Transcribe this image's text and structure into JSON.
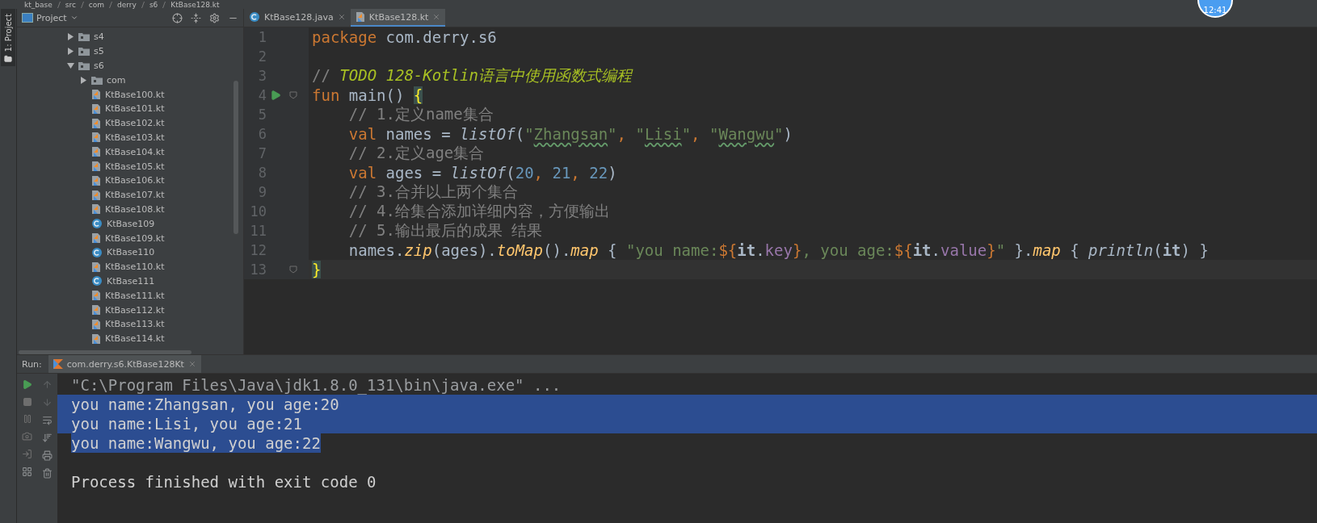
{
  "breadcrumb": [
    "kt_base",
    "src",
    "com",
    "derry",
    "s6",
    "KtBase128.kt"
  ],
  "clock_badge": "12:41",
  "tool_stripe": {
    "label": "1: Project"
  },
  "project_panel": {
    "title": "Project",
    "tree": [
      {
        "label": "s4",
        "kind": "folder",
        "expanded": false
      },
      {
        "label": "s5",
        "kind": "folder",
        "expanded": false
      },
      {
        "label": "s6",
        "kind": "folder",
        "expanded": true,
        "children": [
          {
            "label": "com",
            "kind": "folder",
            "expanded": false
          },
          {
            "label": "KtBase100.kt",
            "kind": "kotlin-file"
          },
          {
            "label": "KtBase101.kt",
            "kind": "kotlin-file"
          },
          {
            "label": "KtBase102.kt",
            "kind": "kotlin-file"
          },
          {
            "label": "KtBase103.kt",
            "kind": "kotlin-file"
          },
          {
            "label": "KtBase104.kt",
            "kind": "kotlin-file"
          },
          {
            "label": "KtBase105.kt",
            "kind": "kotlin-file"
          },
          {
            "label": "KtBase106.kt",
            "kind": "kotlin-file"
          },
          {
            "label": "KtBase107.kt",
            "kind": "kotlin-file"
          },
          {
            "label": "KtBase108.kt",
            "kind": "kotlin-file"
          },
          {
            "label": "KtBase109",
            "kind": "class"
          },
          {
            "label": "KtBase109.kt",
            "kind": "kotlin-file"
          },
          {
            "label": "KtBase110",
            "kind": "class"
          },
          {
            "label": "KtBase110.kt",
            "kind": "kotlin-file"
          },
          {
            "label": "KtBase111",
            "kind": "class"
          },
          {
            "label": "KtBase111.kt",
            "kind": "kotlin-file"
          },
          {
            "label": "KtBase112.kt",
            "kind": "kotlin-file"
          },
          {
            "label": "KtBase113.kt",
            "kind": "kotlin-file"
          },
          {
            "label": "KtBase114.kt",
            "kind": "kotlin-file"
          }
        ]
      }
    ]
  },
  "editor_tabs": [
    {
      "label": "KtBase128.java",
      "kind": "java",
      "selected": false
    },
    {
      "label": "KtBase128.kt",
      "kind": "kotlin",
      "selected": true
    }
  ],
  "code_lines": [
    {
      "number": "1",
      "tokens": [
        {
          "text": "package",
          "kind": "keyword"
        },
        {
          "text": " com.derry.s6",
          "kind": "plain"
        }
      ]
    },
    {
      "number": "2"
    },
    {
      "number": "3",
      "tokens": [
        {
          "text": "// ",
          "kind": "comment"
        },
        {
          "text": "TODO 128-Kotlin语言中使用函数式编程",
          "kind": "todo"
        }
      ]
    },
    {
      "number": "4",
      "runnable": true,
      "fold": true,
      "tokens": [
        {
          "text": "fun",
          "kind": "keyword"
        },
        {
          "text": " main() ",
          "kind": "plain"
        },
        {
          "text": "{",
          "kind": "brace-match"
        }
      ]
    },
    {
      "number": "5",
      "tokens": [
        {
          "text": "    // 1.定义name集合",
          "kind": "comment"
        }
      ]
    },
    {
      "number": "6",
      "tokens": [
        {
          "text": "    val",
          "kind": "keyword"
        },
        {
          "text": " names = ",
          "kind": "plain"
        },
        {
          "text": "listOf",
          "kind": "call"
        },
        {
          "text": "(",
          "kind": "plain"
        },
        {
          "text": "\"",
          "kind": "string"
        },
        {
          "text": "Zhangsan",
          "kind": "string-typo"
        },
        {
          "text": "\"",
          "kind": "string"
        },
        {
          "text": ", ",
          "kind": "keyword"
        },
        {
          "text": "\"",
          "kind": "string"
        },
        {
          "text": "Lisi",
          "kind": "string-typo"
        },
        {
          "text": "\"",
          "kind": "string"
        },
        {
          "text": ", ",
          "kind": "keyword"
        },
        {
          "text": "\"",
          "kind": "string"
        },
        {
          "text": "Wangwu",
          "kind": "string-typo"
        },
        {
          "text": "\"",
          "kind": "string"
        },
        {
          "text": ")",
          "kind": "plain"
        }
      ]
    },
    {
      "number": "7",
      "tokens": [
        {
          "text": "    // 2.定义age集合",
          "kind": "comment"
        }
      ]
    },
    {
      "number": "8",
      "tokens": [
        {
          "text": "    val",
          "kind": "keyword"
        },
        {
          "text": " ages = ",
          "kind": "plain"
        },
        {
          "text": "listOf",
          "kind": "call"
        },
        {
          "text": "(",
          "kind": "plain"
        },
        {
          "text": "20",
          "kind": "number"
        },
        {
          "text": ", ",
          "kind": "keyword"
        },
        {
          "text": "21",
          "kind": "number"
        },
        {
          "text": ", ",
          "kind": "keyword"
        },
        {
          "text": "22",
          "kind": "number"
        },
        {
          "text": ")",
          "kind": "plain"
        }
      ]
    },
    {
      "number": "9",
      "tokens": [
        {
          "text": "    // 3.合并以上两个集合",
          "kind": "comment"
        }
      ]
    },
    {
      "number": "10",
      "tokens": [
        {
          "text": "    // 4.给集合添加详细内容，方便输出",
          "kind": "comment"
        }
      ]
    },
    {
      "number": "11",
      "tokens": [
        {
          "text": "    // 5.输出最后的成果 结果",
          "kind": "comment"
        }
      ]
    },
    {
      "number": "12",
      "tokens": [
        {
          "text": "    names.",
          "kind": "plain"
        },
        {
          "text": "zip",
          "kind": "extension"
        },
        {
          "text": "(ages).",
          "kind": "plain"
        },
        {
          "text": "toMap",
          "kind": "extension"
        },
        {
          "text": "().",
          "kind": "plain"
        },
        {
          "text": "map",
          "kind": "extension"
        },
        {
          "text": " { ",
          "kind": "plain"
        },
        {
          "text": "\"you name:",
          "kind": "string"
        },
        {
          "text": "${",
          "kind": "template"
        },
        {
          "text": "it",
          "kind": "it"
        },
        {
          "text": ".",
          "kind": "plain"
        },
        {
          "text": "key",
          "kind": "property"
        },
        {
          "text": "}",
          "kind": "template"
        },
        {
          "text": ", you age:",
          "kind": "string"
        },
        {
          "text": "${",
          "kind": "template"
        },
        {
          "text": "it",
          "kind": "it"
        },
        {
          "text": ".",
          "kind": "plain"
        },
        {
          "text": "value",
          "kind": "property"
        },
        {
          "text": "}",
          "kind": "template"
        },
        {
          "text": "\"",
          "kind": "string"
        },
        {
          "text": " }.",
          "kind": "plain"
        },
        {
          "text": "map",
          "kind": "extension"
        },
        {
          "text": " { ",
          "kind": "plain"
        },
        {
          "text": "println",
          "kind": "call"
        },
        {
          "text": "(",
          "kind": "plain"
        },
        {
          "text": "it",
          "kind": "it"
        },
        {
          "text": ") }",
          "kind": "plain"
        }
      ]
    },
    {
      "number": "13",
      "current": true,
      "fold": true,
      "tokens": [
        {
          "text": "}",
          "kind": "brace-match"
        }
      ]
    }
  ],
  "run_panel": {
    "label": "Run:",
    "tab": "com.derry.s6.KtBase128Kt",
    "console": [
      {
        "text": "\"C:\\Program Files\\Java\\jdk1.8.0_131\\bin\\java.exe\" ...",
        "kind": "command",
        "selected": false
      },
      {
        "text": "you name:Zhangsan, you age:20",
        "kind": "output",
        "selected": true
      },
      {
        "text": "you name:Lisi, you age:21",
        "kind": "output",
        "selected": true
      },
      {
        "text": "you name:Wangwu, you age:22",
        "kind": "output",
        "selected": true
      },
      {
        "kind": "blank",
        "selected": false
      },
      {
        "text": "Process finished with exit code 0",
        "kind": "output",
        "selected": false
      }
    ]
  }
}
